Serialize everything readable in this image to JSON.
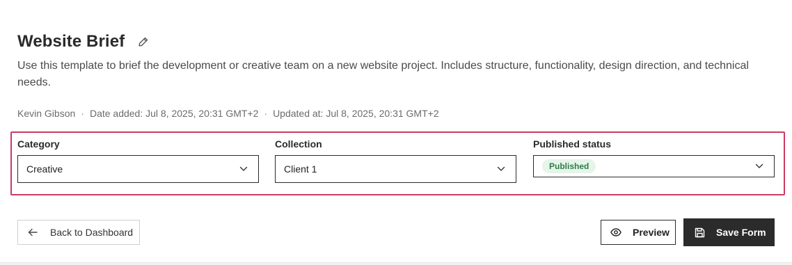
{
  "header": {
    "title": "Website Brief",
    "description": "Use this template to brief the development or creative team on a new website project. Includes structure, functionality, design direction, and technical needs."
  },
  "meta": {
    "author": "Kevin Gibson",
    "date_added": "Date added: Jul 8, 2025, 20:31 GMT+2",
    "updated_at": "Updated at: Jul 8, 2025, 20:31 GMT+2",
    "separator": "·"
  },
  "fields": {
    "category": {
      "label": "Category",
      "value": "Creative"
    },
    "collection": {
      "label": "Collection",
      "value": "Client 1"
    },
    "published_status": {
      "label": "Published status",
      "value": "Published"
    }
  },
  "actions": {
    "back_label": "Back to Dashboard",
    "preview_label": "Preview",
    "save_label": "Save Form"
  },
  "icons": {
    "edit": "pencil-icon",
    "chevron": "chevron-down-icon",
    "back": "arrow-left-icon",
    "preview": "eye-icon",
    "save": "floppy-disk-icon"
  },
  "colors": {
    "highlight_border": "#cc3b63",
    "badge_bg": "#e6f4ea",
    "badge_text": "#2e7d46",
    "primary_button": "#2b2b2b"
  }
}
